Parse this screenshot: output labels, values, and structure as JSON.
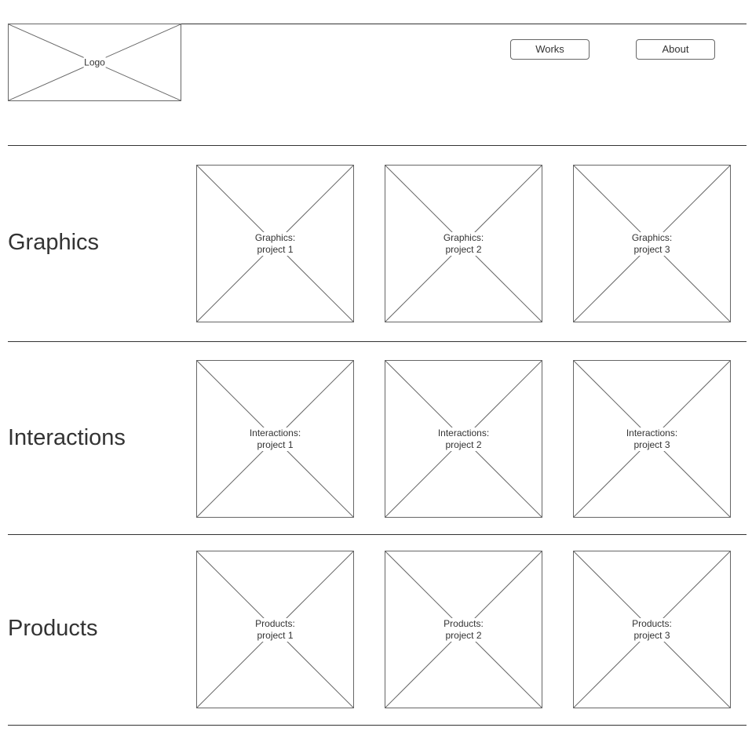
{
  "header": {
    "logo_label": "Logo",
    "nav": [
      {
        "label": "Works"
      },
      {
        "label": "About"
      }
    ]
  },
  "sections": [
    {
      "title": "Graphics",
      "projects": [
        {
          "line1": "Graphics:",
          "line2": "project 1"
        },
        {
          "line1": "Graphics:",
          "line2": "project 2"
        },
        {
          "line1": "Graphics:",
          "line2": "project 3"
        }
      ]
    },
    {
      "title": "Interactions",
      "projects": [
        {
          "line1": "Interactions:",
          "line2": "project 1"
        },
        {
          "line1": "Interactions:",
          "line2": "project 2"
        },
        {
          "line1": "Interactions:",
          "line2": "project 3"
        }
      ]
    },
    {
      "title": "Products",
      "projects": [
        {
          "line1": "Products:",
          "line2": "project 1"
        },
        {
          "line1": "Products:",
          "line2": "project 2"
        },
        {
          "line1": "Products:",
          "line2": "project 3"
        }
      ]
    }
  ],
  "icons": {
    "placeholder": "image-placeholder-icon"
  },
  "colors": {
    "line": "#333333",
    "border": "#666666",
    "text": "#333333"
  }
}
